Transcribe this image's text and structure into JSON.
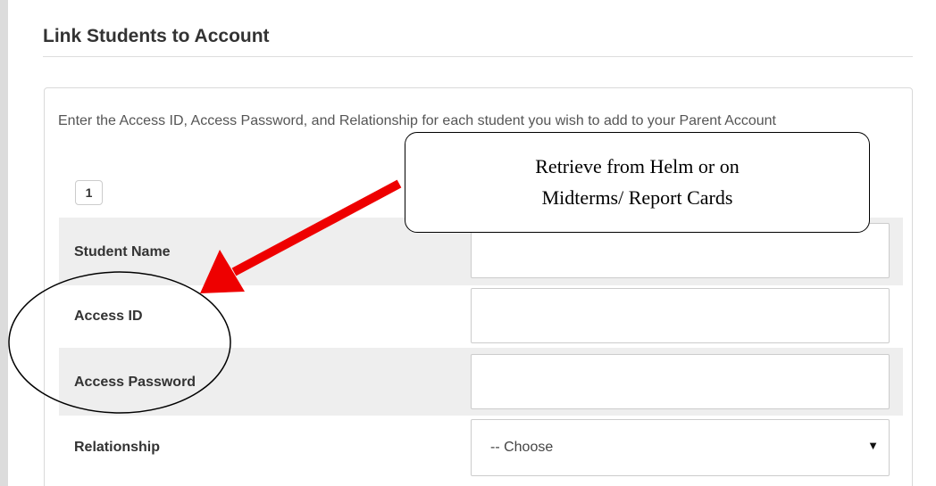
{
  "section": {
    "title": "Link Students to Account"
  },
  "panel": {
    "instructions": "Enter the Access ID, Access Password, and Relationship for each student you wish to add to your Parent Account",
    "page_number": "1"
  },
  "form": {
    "student_name": {
      "label": "Student Name",
      "value": ""
    },
    "access_id": {
      "label": "Access ID",
      "value": ""
    },
    "access_password": {
      "label": "Access Password",
      "value": ""
    },
    "relationship": {
      "label": "Relationship",
      "selected": "-- Choose"
    }
  },
  "annotation": {
    "callout_text": "Retrieve from Helm or on\nMidterms/ Report Cards",
    "arrow_color": "#ee0000",
    "outline_color": "#000000"
  },
  "icons": {
    "select_caret": "▼"
  }
}
